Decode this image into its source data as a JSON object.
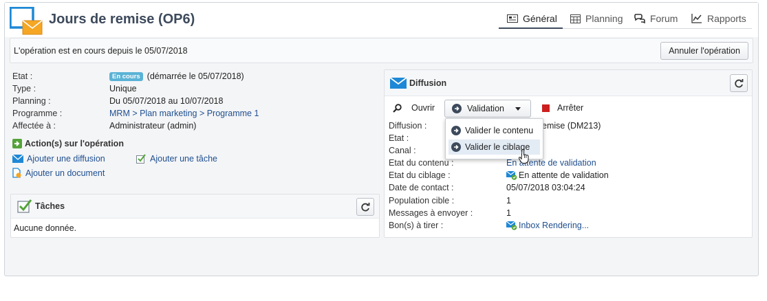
{
  "header": {
    "title": "Jours de remise (OP6)",
    "tabs": [
      {
        "label": "Général",
        "icon": "general-icon",
        "active": true
      },
      {
        "label": "Planning",
        "icon": "calendar-icon"
      },
      {
        "label": "Forum",
        "icon": "forum-icon"
      },
      {
        "label": "Rapports",
        "icon": "chart-icon"
      }
    ]
  },
  "status_bar": {
    "text": "L'opération est en cours depuis le 05/07/2018",
    "cancel_label": "Annuler l'opération"
  },
  "details": {
    "etat_label": "Etat :",
    "etat_badge": "En cours",
    "etat_value": "(démarrée le 05/07/2018)",
    "type_label": "Type :",
    "type_value": "Unique",
    "planning_label": "Planning :",
    "planning_value": "Du 05/07/2018 au 10/07/2018",
    "programme_label": "Programme :",
    "programme_value": "MRM > Plan marketing > Programme 1",
    "affectee_label": "Affectée à :",
    "affectee_value": "Administrateur (admin)"
  },
  "actions": {
    "title": "Action(s) sur l'opération",
    "add_delivery": "Ajouter une diffusion",
    "add_task": "Ajouter une tâche",
    "add_document": "Ajouter un document"
  },
  "tasks": {
    "title": "Tâches",
    "empty": "Aucune donnée."
  },
  "diffusion": {
    "title": "Diffusion",
    "open_label": "Ouvrir",
    "validation_label": "Validation",
    "stop_label": "Arrêter",
    "menu": {
      "item1": "Valider le contenu",
      "item2": "Valider le ciblage",
      "hovered": "item2"
    },
    "rows": {
      "diffusion_label": "Diffusion :",
      "diffusion_value": "emise (DM213)",
      "etat_label": "Etat :",
      "canal_label": "Canal :",
      "etat_contenu_label": "Etat du contenu :",
      "etat_contenu_value": "En attente de validation",
      "etat_ciblage_label": "Etat du ciblage :",
      "etat_ciblage_value": "En attente de validation",
      "date_label": "Date de contact :",
      "date_value": "05/07/2018 03:04:24",
      "population_label": "Population cible :",
      "population_value": "1",
      "messages_label": "Messages à envoyer :",
      "messages_value": "1",
      "bat_label": "Bon(s) à tirer :",
      "bat_value": "Inbox Rendering..."
    }
  },
  "colors": {
    "accent_blue": "#1e88d6",
    "title_dark": "#3d4a5c",
    "link": "#1f4f8f",
    "stop_red": "#cc1f1f",
    "badge": "#5ab3d6",
    "check_green": "#54a33a"
  }
}
